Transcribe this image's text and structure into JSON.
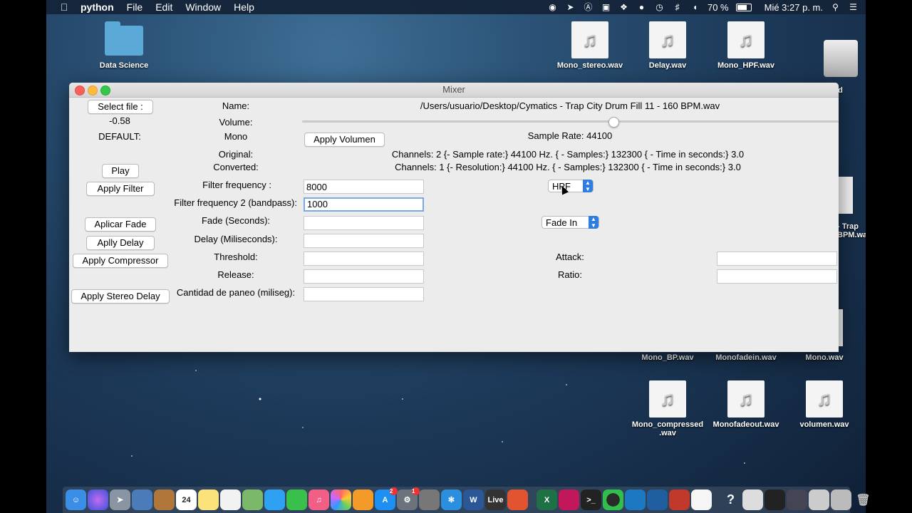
{
  "menubar": {
    "app_name": "python",
    "menus": [
      "File",
      "Edit",
      "Window",
      "Help"
    ],
    "battery": "70 %",
    "clock": "Mié 3:27 p. m."
  },
  "desktop_icons": {
    "data_science": "Data Science",
    "mono_stereo": "Mono_stereo.wav",
    "delay": "Delay.wav",
    "mono_hpf": "Mono_HPF.wav",
    "partial_ed": "ed",
    "partial_trap_1": "- Trap",
    "partial_trap_2": "BPM.wa",
    "mono_bp": "Mono_BP.wav",
    "monofadein": "Monofadein.wav",
    "mono": "Mono.wav",
    "mono_compressed_1": "Mono_compressed",
    "mono_compressed_2": ".wav",
    "monofadeout": "Monofadeout.wav",
    "volumen": "volumen.wav"
  },
  "window": {
    "title": "Mixer",
    "select_file_label": "Select file :",
    "volume_value": "-0.58",
    "default_label": "DEFAULT:",
    "name_label": "Name:",
    "file_path": "/Users/usuario/Desktop/Cymatics - Trap City Drum Fill 11 - 160 BPM.wav",
    "volume_label": "Volume:",
    "volume_level": 0.58,
    "mono_label": "Mono",
    "apply_volumen_label": "Apply Volumen",
    "sample_rate": "Sample Rate: 44100",
    "original_label": "Original:",
    "original_info": "Channels: 2 {- Sample rate:} 44100 Hz. { - Samples:} 132300 { - Time in seconds:} 3.0",
    "converted_label": "Converted:",
    "converted_info": "Channels: 1 {- Resolution:} 44100 Hz. { - Samples:} 132300 { - Time in seconds:} 3.0",
    "play_label": "Play",
    "apply_filter_label": "Apply Filter",
    "filter_freq_label": "Filter frequency :",
    "filter_freq_value": "8000",
    "filter_type_value": "HPF",
    "filter_freq2_label": "Filter frequency 2 (bandpass):",
    "filter_freq2_value": "1000",
    "aplicar_fade_label": "Aplicar Fade",
    "fade_seconds_label": "Fade (Seconds):",
    "fade_seconds_value": "",
    "fade_type_value": "Fade In",
    "aplly_delay_label": "Aplly Delay",
    "delay_label": "Delay (Miliseconds):",
    "delay_value": "",
    "apply_compressor_label": "Apply Compressor",
    "threshold_label": "Threshold:",
    "threshold_value": "",
    "attack_label": "Attack:",
    "attack_value": "",
    "release_label": "Release:",
    "release_value": "",
    "ratio_label": "Ratio:",
    "ratio_value": "",
    "apply_stereo_delay_label": "Apply Stereo Delay",
    "paneo_label": "Cantidad de paneo (miliseg):",
    "paneo_value": ""
  },
  "dock": {
    "calendar_day": "24",
    "live_label": "Live",
    "appstore_badge": "2",
    "prefs_badge": "1"
  }
}
